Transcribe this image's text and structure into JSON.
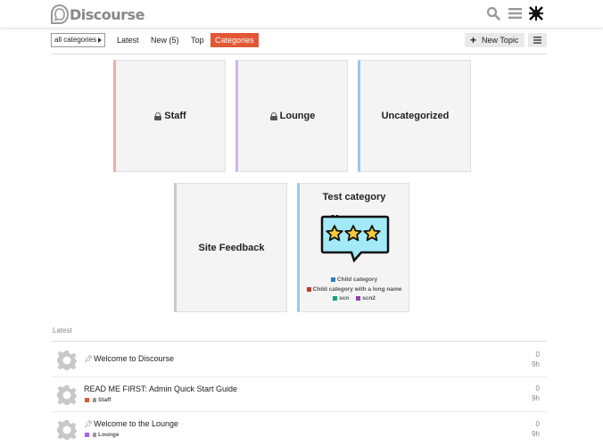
{
  "header": {
    "logo_text": "Discourse",
    "icons": [
      "search-icon",
      "hamburger-icon",
      "user-avatar"
    ]
  },
  "nav": {
    "category_dropdown": "all categories",
    "items": [
      "Latest",
      "New (5)",
      "Top",
      "Categories"
    ],
    "active": "Categories",
    "new_topic": "New Topic",
    "accent_color": "#e45735"
  },
  "categories": [
    {
      "name": "Staff",
      "locked": true,
      "color": "#e8b3a1"
    },
    {
      "name": "Lounge",
      "locked": true,
      "color": "#d2b3e6"
    },
    {
      "name": "Uncategorized",
      "locked": false,
      "color": "#9cc9e4"
    },
    {
      "name": "Site Feedback",
      "locked": false,
      "color": "#c8c8c8"
    },
    {
      "name": "Test category",
      "locked": false,
      "color": "#9cc9e4",
      "subcategories": [
        {
          "name": "Child category",
          "color": "#2980b9"
        },
        {
          "name": "Child category with a long name",
          "color": "#c0392b"
        },
        {
          "name": "scn",
          "color": "#16a085"
        },
        {
          "name": "scn2",
          "color": "#8e44ad"
        }
      ]
    }
  ],
  "latest": {
    "label": "Latest",
    "topics": [
      {
        "title": "Welcome to Discourse",
        "pinned": true,
        "category": "",
        "category_color": "",
        "replies": "0",
        "age": "9h"
      },
      {
        "title": "READ ME FIRST: Admin Quick Start Guide",
        "pinned": false,
        "category": "Staff",
        "category_color": "#e45735",
        "replies": "0",
        "age": "9h"
      },
      {
        "title": "Welcome to the Lounge",
        "pinned": true,
        "category": "Lounge",
        "category_color": "#a461ef",
        "replies": "0",
        "age": "9h"
      }
    ]
  }
}
